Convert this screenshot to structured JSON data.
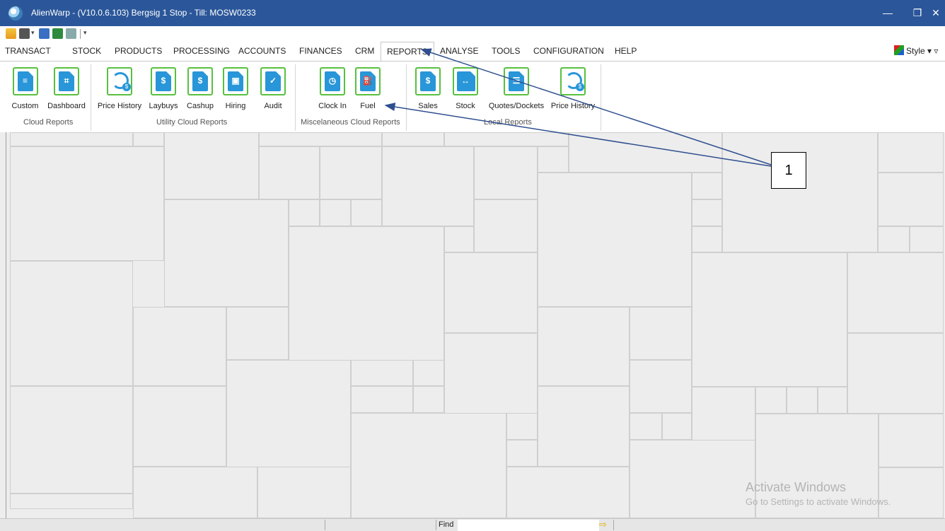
{
  "window": {
    "title": "AlienWarp - (V10.0.6.103) Bergsig 1 Stop - Till: MOSW0233",
    "min_glyph": "—",
    "max_glyph": "❐",
    "close_glyph": "✕"
  },
  "menu": {
    "tabs": [
      "TRANSACT",
      "STOCK",
      "PRODUCTS",
      "PROCESSING",
      "ACCOUNTS",
      "FINANCES",
      "CRM",
      "REPORTS",
      "ANALYSE",
      "TOOLS",
      "CONFIGURATION",
      "HELP"
    ],
    "active": "REPORTS",
    "style_label": "Style ▾ ▿"
  },
  "ribbon": {
    "groups": [
      {
        "label": "Cloud Reports",
        "buttons": [
          "Custom",
          "Dashboard"
        ]
      },
      {
        "label": "Utility Cloud Reports",
        "buttons": [
          "Price History",
          "Laybuys",
          "Cashup",
          "Hiring",
          "Audit"
        ]
      },
      {
        "label": "Miscelaneous Cloud Reports",
        "buttons": [
          "Clock In",
          "Fuel"
        ]
      },
      {
        "label": "Local Reports",
        "buttons": [
          "Sales",
          "Stock",
          "Quotes/Dockets",
          "Price History"
        ]
      }
    ]
  },
  "annotation": {
    "callout": "1"
  },
  "watermark": {
    "line1": "Activate Windows",
    "line2": "Go to Settings to activate Windows."
  },
  "statusbar": {
    "find_label": "Find",
    "find_value": "",
    "go_glyph": "⇨"
  },
  "colors": {
    "titlebar": "#2b579a",
    "icon_border": "#58c03f",
    "icon_fill": "#2896d8",
    "workspace": "#ededed"
  }
}
